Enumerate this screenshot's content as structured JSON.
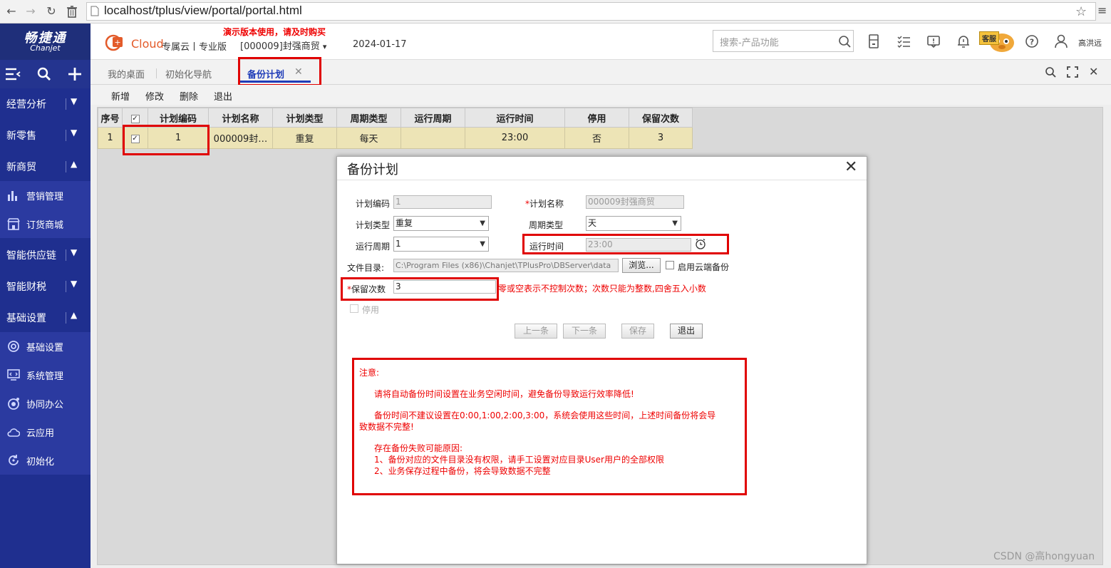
{
  "browser": {
    "url": "localhost/tplus/view/portal/portal.html"
  },
  "header": {
    "logo_cn": "畅捷通",
    "logo_en": "Chanjet",
    "brand": "Cloud",
    "edition": "专属云丨专业版",
    "promo": "演示版本使用，请及时购买",
    "company": "[000009]封强商贸",
    "date": "2024-01-17",
    "search_placeholder": "搜索-产品功能",
    "service_badge": "客服",
    "user": "高洪远"
  },
  "sidebar": {
    "groups": [
      {
        "label": "经营分析",
        "expanded": false
      },
      {
        "label": "新零售",
        "expanded": false
      },
      {
        "label": "新商贸",
        "expanded": true
      },
      {
        "label": "智能供应链",
        "expanded": false
      },
      {
        "label": "智能财税",
        "expanded": false
      },
      {
        "label": "基础设置",
        "expanded": true
      }
    ],
    "sub_trade": [
      {
        "label": "营销管理",
        "icon": "bar-chart-icon"
      },
      {
        "label": "订货商城",
        "icon": "shop-icon"
      }
    ],
    "sub_basic": [
      {
        "label": "基础设置",
        "icon": "gear-icon"
      },
      {
        "label": "系统管理",
        "icon": "monitor-code-icon"
      },
      {
        "label": "协同办公",
        "icon": "collab-icon"
      },
      {
        "label": "云应用",
        "icon": "cloud-icon"
      },
      {
        "label": "初始化",
        "icon": "refresh-icon"
      }
    ]
  },
  "tabs": [
    {
      "label": "我的桌面"
    },
    {
      "label": "初始化导航"
    },
    {
      "label": "备份计划",
      "active": true
    }
  ],
  "toolbar": {
    "add": "新增",
    "edit": "修改",
    "delete": "删除",
    "exit": "退出"
  },
  "grid": {
    "headers": [
      "序号",
      "",
      "计划编码",
      "计划名称",
      "计划类型",
      "周期类型",
      "运行周期",
      "运行时间",
      "停用",
      "保留次数"
    ],
    "row": {
      "seq": "1",
      "checked": true,
      "code": "1",
      "name": "000009封…",
      "type": "重复",
      "cycle_type": "每天",
      "run_cycle": "",
      "run_time": "23:00",
      "disabled": "否",
      "keep": "3"
    }
  },
  "dialog": {
    "title": "备份计划",
    "close": "✕",
    "code_label": "计划编码",
    "code_value": "1",
    "name_label": "计划名称",
    "name_value": "000009封强商贸",
    "type_label": "计划类型",
    "type_value": "重复",
    "cycle_type_label": "周期类型",
    "cycle_type_value": "天",
    "run_cycle_label": "运行周期",
    "run_cycle_value": "1",
    "run_time_label": "运行时间",
    "run_time_value": "23:00",
    "dir_label": "文件目录:",
    "dir_value": "C:\\Program Files (x86)\\Chanjet\\TPlusPro\\DBServer\\data",
    "browse": "浏览...",
    "cloud_backup": "启用云端备份",
    "keep_label": "保留次数",
    "keep_value": "3",
    "keep_hint": "零或空表示不控制次数；次数只能为整数,四舍五入小数",
    "disabled_label": "停用",
    "prev": "上一条",
    "next": "下一条",
    "save": "保存",
    "exit": "退出",
    "note_title": "注意:",
    "note1": "请将自动备份时间设置在业务空闲时间，避免备份导致运行效率降低!",
    "note2a": "备份时间不建议设置在0:00,1:00,2:00,3:00，系统会使用这些时间，上述时间备份将会导",
    "note2b": "致数据不完整!",
    "note3": "存在备份失败可能原因:",
    "note4": "1、备份对应的文件目录没有权限，请手工设置对应目录User用户的全部权限",
    "note5": "2、业务保存过程中备份，将会导致数据不完整"
  },
  "watermark": "CSDN @高hongyuan",
  "colors": {
    "sidebar": "#1f2f8f",
    "highlight": "#e00000",
    "tab_active": "#1f3cb8",
    "row": "#ede4b6"
  }
}
